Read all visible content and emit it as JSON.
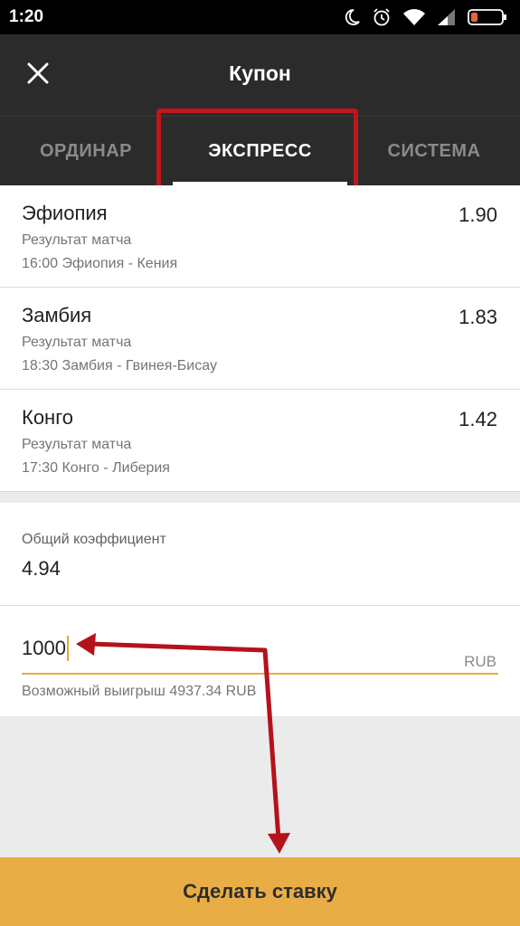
{
  "status_bar": {
    "time": "1:20",
    "icons": [
      "moon-icon",
      "alarm-icon",
      "wifi-icon",
      "signal-icon",
      "battery-icon"
    ],
    "battery_color": "#e8643a"
  },
  "header": {
    "title": "Купон",
    "close_icon": "close-icon"
  },
  "tabs": [
    {
      "label": "ОРДИНАР",
      "active": false
    },
    {
      "label": "ЭКСПРЕСС",
      "active": true
    },
    {
      "label": "СИСТЕМА",
      "active": false
    }
  ],
  "bets": [
    {
      "name": "Эфиопия",
      "odds": "1.90",
      "market": "Результат матча",
      "event": "16:00 Эфиопия - Кения"
    },
    {
      "name": "Замбия",
      "odds": "1.83",
      "market": "Результат матча",
      "event": "18:30 Замбия - Гвинея-Бисау"
    },
    {
      "name": "Конго",
      "odds": "1.42",
      "market": "Результат матча",
      "event": "17:30 Конго - Либерия"
    }
  ],
  "total": {
    "label": "Общий коэффициент",
    "value": "4.94"
  },
  "stake": {
    "value": "1000",
    "currency": "RUB",
    "possible_win": "Возможный выигрыш 4937.34 RUB"
  },
  "actions": {
    "place_bet_label": "Сделать ставку"
  },
  "colors": {
    "app_bar": "#2b2b2b",
    "accent": "#e8ae45",
    "highlight": "#c0151b",
    "annotation_arrow": "#b5121b"
  }
}
